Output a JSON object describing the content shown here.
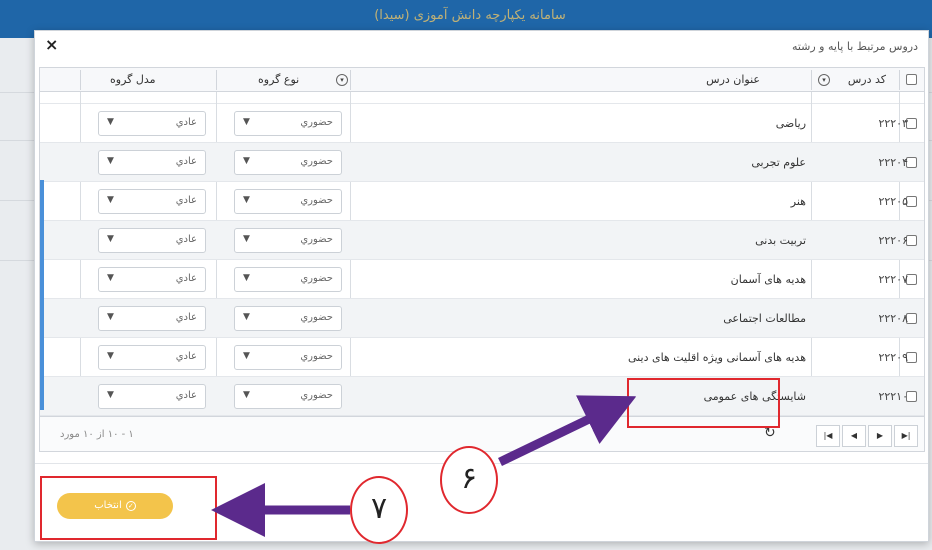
{
  "background": {
    "title": "سامانه یکپارچه دانش آموزی (سیدا)",
    "accent_color": "#1f66a8"
  },
  "modal": {
    "title": "دروس مرتبط با پایه و رشته",
    "close_label": "×",
    "columns": {
      "code": "کد درس",
      "course_title": "عنوان درس",
      "group_type": "نوع گروه",
      "group_model": "مدل گروه"
    },
    "rows": [
      {
        "code": "۲۲۲۰۳",
        "title": "ریاضی",
        "group_type": "حضوري",
        "group_model": "عادي"
      },
      {
        "code": "۲۲۲۰۴",
        "title": "علوم تجربی",
        "group_type": "حضوري",
        "group_model": "عادي"
      },
      {
        "code": "۲۲۲۰۵",
        "title": "هنر",
        "group_type": "حضوري",
        "group_model": "عادي"
      },
      {
        "code": "۲۲۲۰۶",
        "title": "تربیت بدنی",
        "group_type": "حضوري",
        "group_model": "عادي"
      },
      {
        "code": "۲۲۲۰۷",
        "title": "هدیه های آسمان",
        "group_type": "حضوري",
        "group_model": "عادي"
      },
      {
        "code": "۲۲۲۰۸",
        "title": "مطالعات اجتماعی",
        "group_type": "حضوري",
        "group_model": "عادي"
      },
      {
        "code": "۲۲۲۰۹",
        "title": "هدیه های آسمانی ویژه اقلیت های دینی",
        "group_type": "حضوري",
        "group_model": "عادي"
      },
      {
        "code": "۲۲۲۱۰",
        "title": "شایستگی های عمومی",
        "group_type": "حضوري",
        "group_model": "عادي"
      }
    ],
    "pager": {
      "first": "|◀",
      "prev": "◀",
      "next": "▶",
      "last": "▶|",
      "refresh": "↻",
      "info": "۱ - ۱۰ از ۱۰ مورد"
    },
    "select_button": {
      "label": "انتخاب",
      "color": "#f3c44b"
    }
  },
  "annotations": {
    "step6": "۶",
    "step7": "۷",
    "callout_color": "#e0282e",
    "arrow_color": "#5b2a8c"
  }
}
